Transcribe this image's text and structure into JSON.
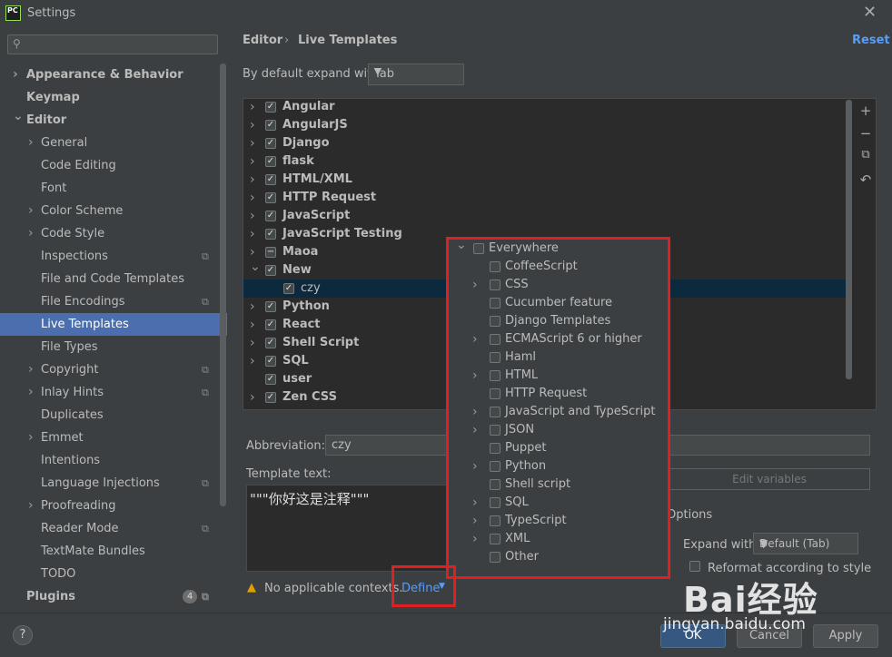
{
  "window": {
    "title": "Settings",
    "app_icon_text": "PC"
  },
  "sidebar": {
    "search_placeholder": "",
    "items": [
      {
        "label": "Appearance & Behavior",
        "bold": true,
        "chevron": ">",
        "indent": 0
      },
      {
        "label": "Keymap",
        "bold": true,
        "chevron": "",
        "indent": 0
      },
      {
        "label": "Editor",
        "bold": true,
        "chevron": "v",
        "indent": 0
      },
      {
        "label": "General",
        "chevron": ">",
        "indent": 1
      },
      {
        "label": "Code Editing",
        "chevron": "",
        "indent": 1
      },
      {
        "label": "Font",
        "chevron": "",
        "indent": 1
      },
      {
        "label": "Color Scheme",
        "chevron": ">",
        "indent": 1
      },
      {
        "label": "Code Style",
        "chevron": ">",
        "indent": 1
      },
      {
        "label": "Inspections",
        "chevron": "",
        "indent": 1,
        "gear": true
      },
      {
        "label": "File and Code Templates",
        "chevron": "",
        "indent": 1
      },
      {
        "label": "File Encodings",
        "chevron": "",
        "indent": 1,
        "gear": true
      },
      {
        "label": "Live Templates",
        "chevron": "",
        "indent": 1,
        "selected": true
      },
      {
        "label": "File Types",
        "chevron": "",
        "indent": 1
      },
      {
        "label": "Copyright",
        "chevron": ">",
        "indent": 1,
        "gear": true
      },
      {
        "label": "Inlay Hints",
        "chevron": ">",
        "indent": 1,
        "gear": true
      },
      {
        "label": "Duplicates",
        "chevron": "",
        "indent": 1
      },
      {
        "label": "Emmet",
        "chevron": ">",
        "indent": 1
      },
      {
        "label": "Intentions",
        "chevron": "",
        "indent": 1
      },
      {
        "label": "Language Injections",
        "chevron": "",
        "indent": 1,
        "gear": true
      },
      {
        "label": "Proofreading",
        "chevron": ">",
        "indent": 1
      },
      {
        "label": "Reader Mode",
        "chevron": "",
        "indent": 1,
        "gear": true
      },
      {
        "label": "TextMate Bundles",
        "chevron": "",
        "indent": 1
      },
      {
        "label": "TODO",
        "chevron": "",
        "indent": 1
      },
      {
        "label": "Plugins",
        "bold": true,
        "chevron": "",
        "indent": 0,
        "gear": true
      }
    ],
    "plugins_badge": "4"
  },
  "header": {
    "crumb1": "Editor",
    "sep": "›",
    "crumb2": "Live Templates",
    "reset": "Reset"
  },
  "expand": {
    "label": "By default expand with",
    "value": "Tab"
  },
  "tree": [
    {
      "label": "Angular",
      "state": "checked",
      "chevron": ">",
      "level": 0
    },
    {
      "label": "AngularJS",
      "state": "checked",
      "chevron": ">",
      "level": 0
    },
    {
      "label": "Django",
      "state": "checked",
      "chevron": ">",
      "level": 0
    },
    {
      "label": "flask",
      "state": "checked",
      "chevron": ">",
      "level": 0
    },
    {
      "label": "HTML/XML",
      "state": "checked",
      "chevron": ">",
      "level": 0
    },
    {
      "label": "HTTP Request",
      "state": "checked",
      "chevron": ">",
      "level": 0
    },
    {
      "label": "JavaScript",
      "state": "checked",
      "chevron": ">",
      "level": 0
    },
    {
      "label": "JavaScript Testing",
      "state": "checked",
      "chevron": ">",
      "level": 0
    },
    {
      "label": "Maoa",
      "state": "partial",
      "chevron": ">",
      "level": 0
    },
    {
      "label": "New",
      "state": "checked",
      "chevron": "v",
      "level": 0
    },
    {
      "label": "czy",
      "state": "checked",
      "chevron": "",
      "level": 1,
      "selected": true
    },
    {
      "label": "Python",
      "state": "checked",
      "chevron": ">",
      "level": 0
    },
    {
      "label": "React",
      "state": "checked",
      "chevron": ">",
      "level": 0
    },
    {
      "label": "Shell Script",
      "state": "checked",
      "chevron": ">",
      "level": 0
    },
    {
      "label": "SQL",
      "state": "checked",
      "chevron": ">",
      "level": 0
    },
    {
      "label": "user",
      "state": "checked",
      "chevron": "",
      "level": 0
    },
    {
      "label": "Zen CSS",
      "state": "checked",
      "chevron": ">",
      "level": 0
    }
  ],
  "tree_buttons": {
    "add": "+",
    "remove": "−",
    "copy": "⧉",
    "restore": "↶"
  },
  "form": {
    "abbr_label": "Abbreviation:",
    "abbr_value": "czy",
    "template_label": "Template text:",
    "template_value": "\"\"\"你好这是注释\"\"\"",
    "edit_variables": "Edit variables",
    "options_label": "Options",
    "expand_with_label": "Expand with",
    "expand_with_value": "Default (Tab)",
    "reformat_label": "Reformat according to style",
    "warning_text": "No applicable contexts.",
    "define_link": "Define"
  },
  "context_popup": [
    {
      "label": "Everywhere",
      "chevron": "v",
      "level": 0
    },
    {
      "label": "CoffeeScript",
      "chevron": "",
      "level": 1
    },
    {
      "label": "CSS",
      "chevron": ">",
      "level": 1
    },
    {
      "label": "Cucumber feature",
      "chevron": "",
      "level": 1
    },
    {
      "label": "Django Templates",
      "chevron": "",
      "level": 1
    },
    {
      "label": "ECMAScript 6 or higher",
      "chevron": ">",
      "level": 1
    },
    {
      "label": "Haml",
      "chevron": "",
      "level": 1
    },
    {
      "label": "HTML",
      "chevron": ">",
      "level": 1
    },
    {
      "label": "HTTP Request",
      "chevron": "",
      "level": 1
    },
    {
      "label": "JavaScript and TypeScript",
      "chevron": ">",
      "level": 1
    },
    {
      "label": "JSON",
      "chevron": ">",
      "level": 1
    },
    {
      "label": "Puppet",
      "chevron": "",
      "level": 1
    },
    {
      "label": "Python",
      "chevron": ">",
      "level": 1
    },
    {
      "label": "Shell script",
      "chevron": "",
      "level": 1
    },
    {
      "label": "SQL",
      "chevron": ">",
      "level": 1
    },
    {
      "label": "TypeScript",
      "chevron": ">",
      "level": 1
    },
    {
      "label": "XML",
      "chevron": ">",
      "level": 1
    },
    {
      "label": "Other",
      "chevron": "",
      "level": 1
    }
  ],
  "footer": {
    "help": "?",
    "ok": "OK",
    "cancel": "Cancel",
    "apply": "Apply"
  },
  "watermark": {
    "brand": "Bai经验",
    "url": "jingyan.baidu.com"
  },
  "colors": {
    "accent": "#4b6eaf",
    "link": "#589df6",
    "highlight_box": "#e02020",
    "ok_button": "#365880"
  }
}
